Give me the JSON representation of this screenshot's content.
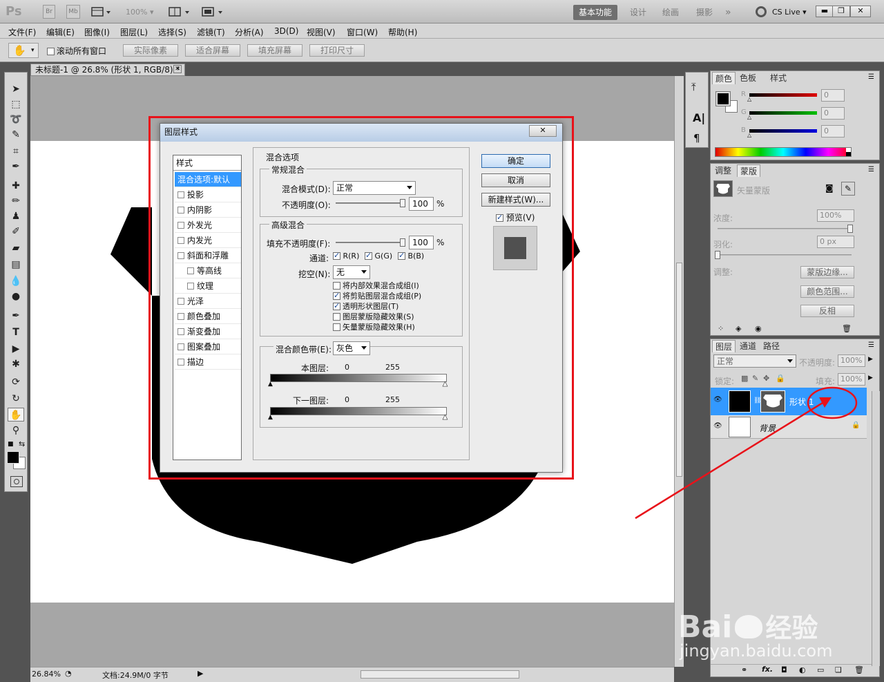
{
  "app": {
    "logo": "Ps",
    "bridge": "Br",
    "minibridge": "Mb",
    "zoom": "100%",
    "workspaces": [
      "基本功能",
      "设计",
      "绘画",
      "摄影"
    ],
    "more": "»",
    "cslive": "CS Live"
  },
  "menu": [
    "文件(F)",
    "编辑(E)",
    "图像(I)",
    "图层(L)",
    "选择(S)",
    "滤镜(T)",
    "分析(A)",
    "3D(D)",
    "视图(V)",
    "窗口(W)",
    "帮助(H)"
  ],
  "options": {
    "scroll_all": "滚动所有窗口",
    "buttons": [
      "实际像素",
      "适合屏幕",
      "填充屏幕",
      "打印尺寸"
    ]
  },
  "document": {
    "tab": "未标题-1 @ 26.8% (形状 1, RGB/8) *",
    "zoom": "26.84%",
    "doc_info": "文档:24.9M/0 字节"
  },
  "dialog": {
    "title": "图层样式",
    "styles_header": "样式",
    "styles": [
      {
        "label": "混合选项:默认",
        "selected": true,
        "indent": false,
        "checkbox": false
      },
      {
        "label": "投影",
        "selected": false,
        "indent": false,
        "checkbox": true
      },
      {
        "label": "内阴影",
        "selected": false,
        "indent": false,
        "checkbox": true
      },
      {
        "label": "外发光",
        "selected": false,
        "indent": false,
        "checkbox": true
      },
      {
        "label": "内发光",
        "selected": false,
        "indent": false,
        "checkbox": true
      },
      {
        "label": "斜面和浮雕",
        "selected": false,
        "indent": false,
        "checkbox": true
      },
      {
        "label": "等高线",
        "selected": false,
        "indent": true,
        "checkbox": true
      },
      {
        "label": "纹理",
        "selected": false,
        "indent": true,
        "checkbox": true
      },
      {
        "label": "光泽",
        "selected": false,
        "indent": false,
        "checkbox": true
      },
      {
        "label": "颜色叠加",
        "selected": false,
        "indent": false,
        "checkbox": true
      },
      {
        "label": "渐变叠加",
        "selected": false,
        "indent": false,
        "checkbox": true
      },
      {
        "label": "图案叠加",
        "selected": false,
        "indent": false,
        "checkbox": true
      },
      {
        "label": "描边",
        "selected": false,
        "indent": false,
        "checkbox": true
      }
    ],
    "blend_options": "混合选项",
    "general_blend": "常规混合",
    "blend_mode_label": "混合模式(D):",
    "blend_mode_value": "正常",
    "opacity_label": "不透明度(O):",
    "opacity_value": "100",
    "percent": "%",
    "advanced_blend": "高级混合",
    "fill_opacity_label": "填充不透明度(F):",
    "fill_opacity_value": "100",
    "channels_label": "通道:",
    "channels": [
      "R(R)",
      "G(G)",
      "B(B)"
    ],
    "knockout_label": "挖空(N):",
    "knockout_value": "无",
    "options": [
      {
        "label": "将内部效果混合成组(I)",
        "checked": false
      },
      {
        "label": "将剪贴图层混合成组(P)",
        "checked": true
      },
      {
        "label": "透明形状图层(T)",
        "checked": true
      },
      {
        "label": "图层蒙版隐藏效果(S)",
        "checked": false
      },
      {
        "label": "矢量蒙版隐藏效果(H)",
        "checked": false
      }
    ],
    "blend_if_label": "混合颜色带(E):",
    "blend_if_value": "灰色",
    "this_layer": "本图层:",
    "underlying_layer": "下一图层:",
    "range_min": "0",
    "range_max": "255",
    "ok": "确定",
    "cancel": "取消",
    "new_style": "新建样式(W)...",
    "preview": "预览(V)"
  },
  "color_panel": {
    "tabs": [
      "颜色",
      "色板",
      "样式"
    ],
    "channels": [
      {
        "label": "R",
        "value": "0"
      },
      {
        "label": "G",
        "value": "0"
      },
      {
        "label": "B",
        "value": "0"
      }
    ]
  },
  "mask_panel": {
    "tabs": [
      "调整",
      "蒙版"
    ],
    "title": "矢量蒙版",
    "density_label": "浓度:",
    "density_value": "100%",
    "feather_label": "羽化:",
    "feather_value": "0 px",
    "adjust_label": "调整:",
    "buttons": [
      "蒙版边缘...",
      "颜色范围...",
      "反相"
    ]
  },
  "layers_panel": {
    "tabs": [
      "图层",
      "通道",
      "路径"
    ],
    "blend_mode": "正常",
    "opacity_label": "不透明度:",
    "opacity_value": "100%",
    "lock_label": "锁定:",
    "fill_label": "填充:",
    "fill_value": "100%",
    "layers": [
      {
        "name": "形状 1",
        "selected": true
      },
      {
        "name": "背景",
        "selected": false
      }
    ]
  },
  "watermark": {
    "brand": "Bai",
    "brand_cn": "经验",
    "url": "jingyan.baidu.com"
  },
  "colors": {
    "accent_selection": "#3399ff",
    "annotation_red": "#e8121a"
  }
}
